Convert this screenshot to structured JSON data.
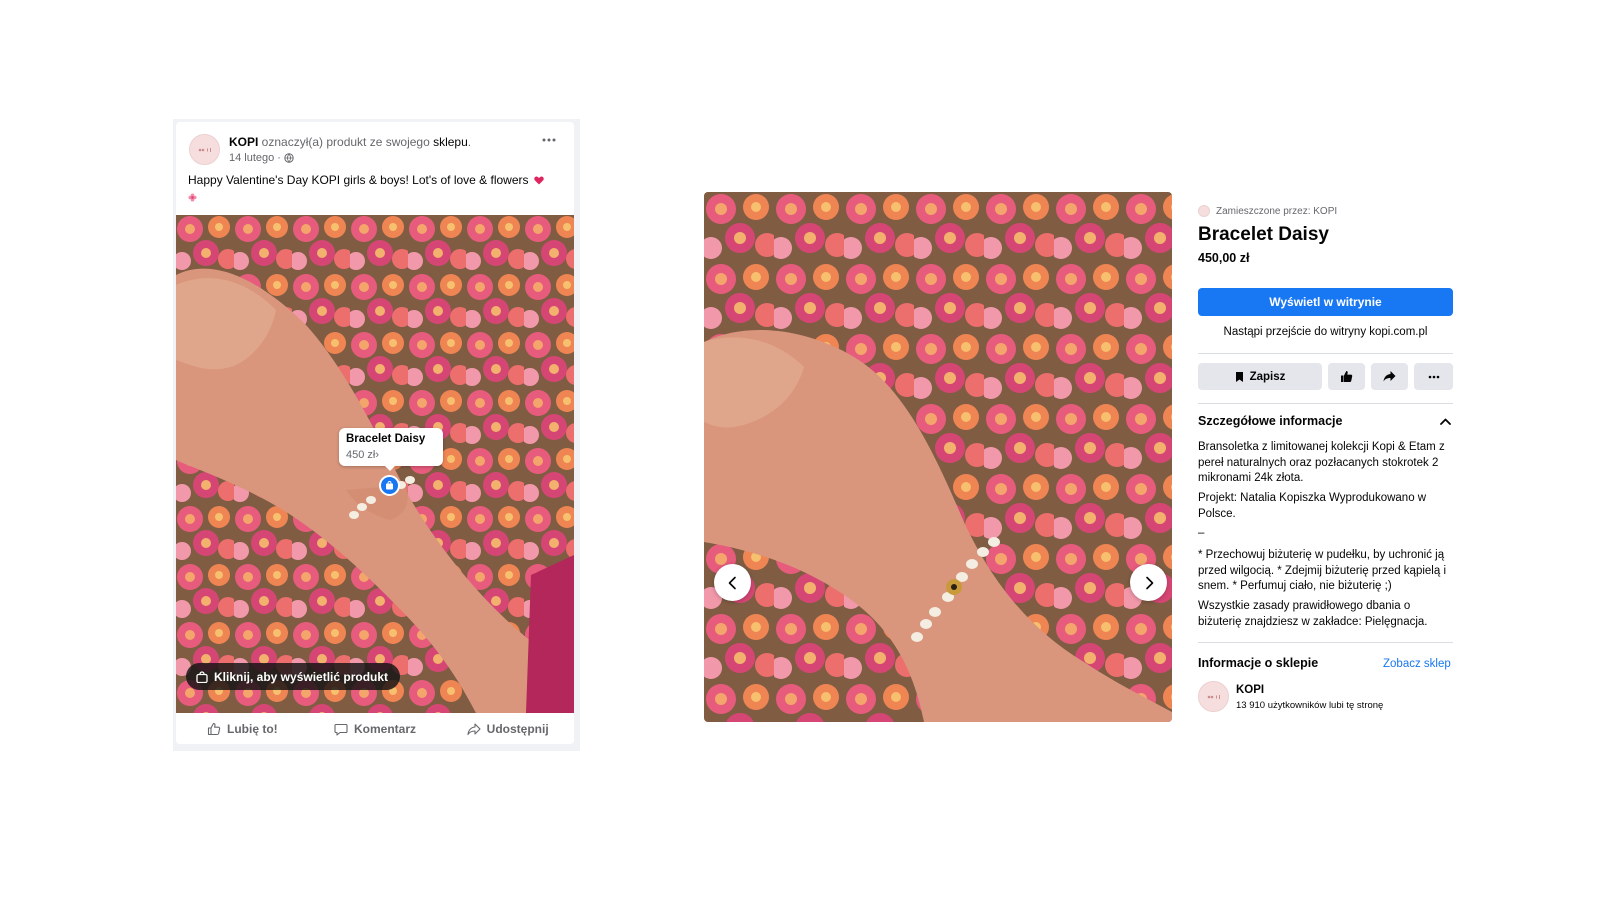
{
  "post": {
    "author": "KOPI",
    "action_text": " oznaczył(a) produkt ze swojego ",
    "shop_word": "sklepu",
    "period": ".",
    "date": "14 lutego",
    "separator": "·",
    "text": "Happy Valentine's Day KOPI girls & boys! Lot's of love & flowers",
    "more_icon": "more-horizontal-icon",
    "tag": {
      "name": "Bracelet Daisy",
      "price": "450 zł",
      "arrow": "›"
    },
    "click_prompt": "Kliknij, aby wyświetlić produkt",
    "actions": {
      "like": "Lubię to!",
      "comment": "Komentarz",
      "share": "Udostępnij"
    }
  },
  "product": {
    "posted_by": "Zamieszczone przez: KOPI",
    "title": "Bracelet Daisy",
    "price": "450,00 zł",
    "view_button": "Wyświetl w witrynie",
    "redirect_note": "Nastąpi przejście do witryny kopi.com.pl",
    "save_button": "Zapisz",
    "details_heading": "Szczegółowe informacje",
    "description": [
      "Bransoletka z limitowanej kolekcji Kopi & Etam z pereł naturalnych oraz pozłacanych stokrotek 2 mikronami 24k złota.",
      "Projekt: Natalia Kopiszka Wyprodukowano w Polsce.",
      "–",
      "* Przechowuj biżuterię w pudełku, by uchronić ją przed wilgocią. * Zdejmij biżuterię przed kąpielą i snem. * Perfumuj ciało, nie biżuterię ;)",
      "Wszystkie zasady prawidłowego dbania o biżuterię znajdziesz w zakładce: Pielęgnacja."
    ],
    "shop_heading": "Informacje o sklepie",
    "see_shop": "Zobacz sklep",
    "shop_name": "KOPI",
    "shop_likes": "13 910 użytkowników lubi tę stronę"
  },
  "colors": {
    "accent": "#1877f2",
    "muted_text": "#65676b",
    "button_gray": "#e4e6eb"
  }
}
